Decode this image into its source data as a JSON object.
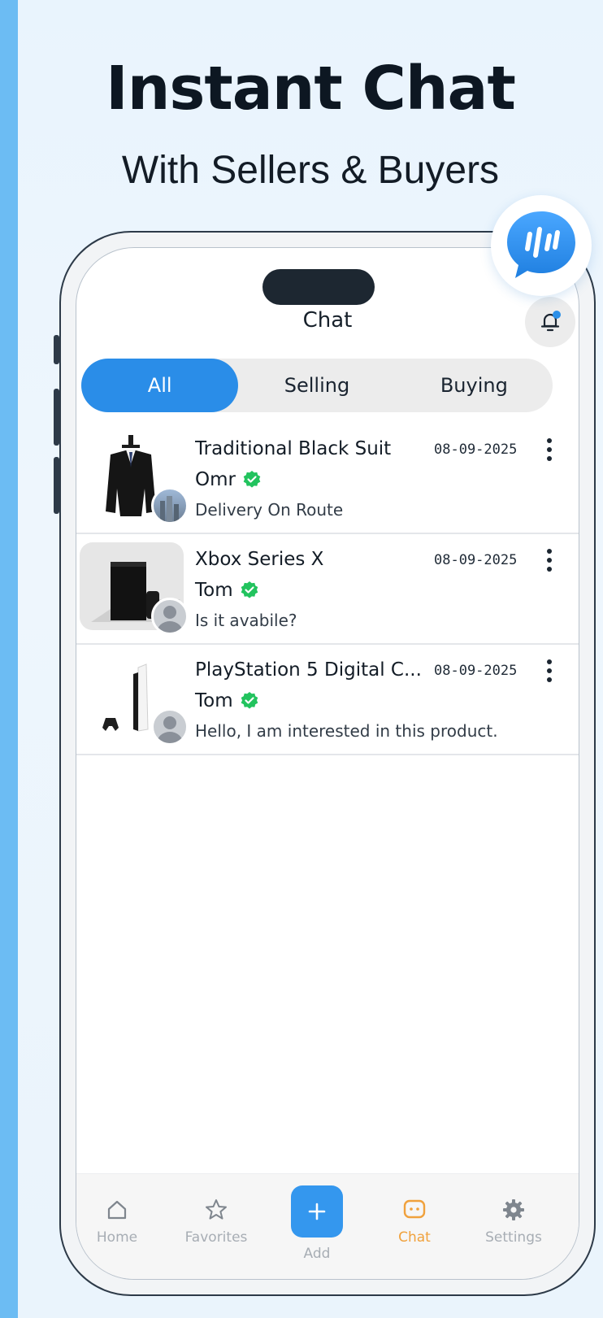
{
  "hero": {
    "headline": "Instant Chat",
    "subheadline": "With Sellers & Buyers"
  },
  "app": {
    "title": "Chat",
    "notification_icon": "bell-icon",
    "has_notification": true
  },
  "tabs": [
    {
      "label": "All",
      "active": true
    },
    {
      "label": "Selling",
      "active": false
    },
    {
      "label": "Buying",
      "active": false
    }
  ],
  "chats": [
    {
      "title": "Traditional Black Suit",
      "date": "08-09-2025",
      "seller": "Omr",
      "verified": true,
      "message": "Delivery On Route",
      "thumbnail": "black-suit-image",
      "avatar": "city-photo-avatar"
    },
    {
      "title": "Xbox Series X",
      "date": "08-09-2025",
      "seller": "Tom",
      "verified": true,
      "message": "Is it avabile?",
      "thumbnail": "xbox-console-image",
      "avatar": "default-user-avatar"
    },
    {
      "title": "PlayStation 5 Digital C...",
      "date": "08-09-2025",
      "seller": "Tom",
      "verified": true,
      "message": "Hello, I am interested in this product.",
      "thumbnail": "ps5-console-image",
      "avatar": "default-user-avatar"
    }
  ],
  "nav": {
    "items": [
      {
        "label": "Home",
        "icon": "home-icon"
      },
      {
        "label": "Favorites",
        "icon": "star-icon"
      },
      {
        "label": "Add",
        "icon": "plus-icon"
      },
      {
        "label": "Chat",
        "icon": "chat-icon",
        "active": true
      },
      {
        "label": "Settings",
        "icon": "gear-icon"
      }
    ]
  },
  "colors": {
    "accent": "#2a8de8",
    "active_nav": "#f0a13c",
    "verified": "#22c35e",
    "outer_background": "#6cbcf3"
  }
}
